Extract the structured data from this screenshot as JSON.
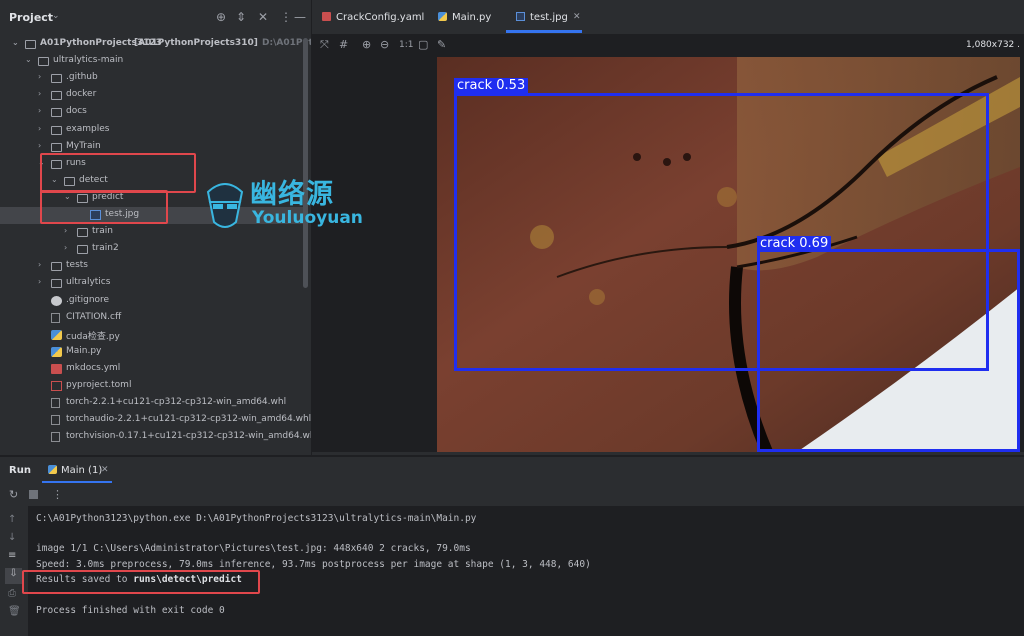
{
  "project": {
    "title": "Project",
    "header_icons": [
      "crosshair-icon",
      "expand-collapse-icon",
      "close-icon",
      "more-icon"
    ],
    "tree": [
      {
        "label": "A01PythonProjects3123",
        "extra": "[A01PythonProjects310]",
        "path": "D:\\A01PythonPr",
        "kind": "folder",
        "indent": 0,
        "open": true
      },
      {
        "label": "ultralytics-main",
        "kind": "folder",
        "indent": 1,
        "open": true
      },
      {
        "label": ".github",
        "kind": "folder",
        "indent": 2
      },
      {
        "label": "docker",
        "kind": "folder",
        "indent": 2
      },
      {
        "label": "docs",
        "kind": "folder",
        "indent": 2
      },
      {
        "label": "examples",
        "kind": "folder",
        "indent": 2
      },
      {
        "label": "MyTrain",
        "kind": "folder",
        "indent": 2
      },
      {
        "label": "runs",
        "kind": "folder",
        "indent": 2,
        "open": true
      },
      {
        "label": "detect",
        "kind": "folder",
        "indent": 3,
        "open": true
      },
      {
        "label": "predict",
        "kind": "folder",
        "indent": 4,
        "open": true
      },
      {
        "label": "test.jpg",
        "kind": "img",
        "indent": 5,
        "selected": true
      },
      {
        "label": "train",
        "kind": "folder",
        "indent": 4
      },
      {
        "label": "train2",
        "kind": "folder",
        "indent": 4
      },
      {
        "label": "tests",
        "kind": "folder",
        "indent": 2
      },
      {
        "label": "ultralytics",
        "kind": "folder",
        "indent": 2
      },
      {
        "label": ".gitignore",
        "kind": "git",
        "indent": 2
      },
      {
        "label": "CITATION.cff",
        "kind": "file",
        "indent": 2
      },
      {
        "label": "cuda检查.py",
        "kind": "py",
        "indent": 2
      },
      {
        "label": "Main.py",
        "kind": "py",
        "indent": 2
      },
      {
        "label": "mkdocs.yml",
        "kind": "yml",
        "indent": 2
      },
      {
        "label": "pyproject.toml",
        "kind": "toml",
        "indent": 2
      },
      {
        "label": "torch-2.2.1+cu121-cp312-cp312-win_amd64.whl",
        "kind": "file",
        "indent": 2
      },
      {
        "label": "torchaudio-2.2.1+cu121-cp312-cp312-win_amd64.whl",
        "kind": "file",
        "indent": 2
      },
      {
        "label": "torchvision-0.17.1+cu121-cp312-cp312-win_amd64.whl",
        "kind": "file",
        "indent": 2
      }
    ]
  },
  "watermark": {
    "cn": "幽络源",
    "en": "Youluoyuan"
  },
  "editor": {
    "tabs": [
      {
        "label": "CrackConfig.yaml",
        "icon": "yaml-file-icon"
      },
      {
        "label": "Main.py",
        "icon": "python-file-icon"
      },
      {
        "label": "test.jpg",
        "icon": "image-file-icon",
        "active": true
      }
    ],
    "toolbar_icons": [
      "fit-icon",
      "grid-icon",
      "zoom-in-icon",
      "zoom-out-icon",
      "actual-size-icon",
      "background-icon",
      "color-picker-icon"
    ],
    "zoom_actual": "1:1",
    "image_dims": "1,080x732 ."
  },
  "detections": [
    {
      "label": "crack",
      "score": "0.53",
      "color": "#1f2ef0"
    },
    {
      "label": "crack",
      "score": "0.69",
      "color": "#1f2ef0"
    }
  ],
  "run": {
    "title": "Run",
    "tab": "Main (1)",
    "console": [
      "C:\\A01Python3123\\python.exe D:\\A01PythonProjects3123\\ultralytics-main\\Main.py",
      "",
      "image 1/1 C:\\Users\\Administrator\\Pictures\\test.jpg: 448x640 2 cracks, 79.0ms",
      "Speed: 3.0ms preprocess, 79.0ms inference, 93.7ms postprocess per image at shape (1, 3, 448, 640)",
      "Results saved to runs\\detect\\predict",
      "",
      "Process finished with exit code 0"
    ]
  },
  "colors": {
    "accent": "#3574f0",
    "highlight_box": "#e0474c",
    "bbox": "#1f2ef0"
  }
}
